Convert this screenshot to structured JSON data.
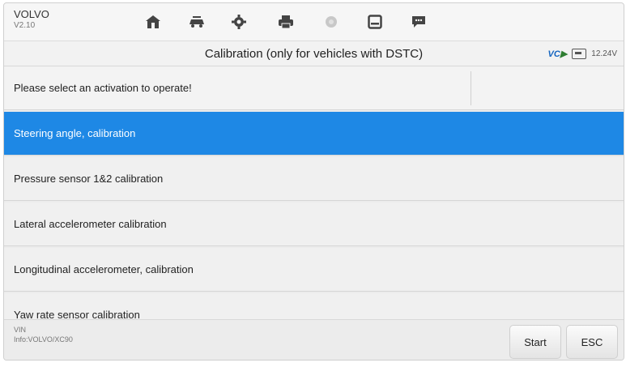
{
  "header": {
    "brand": "VOLVO",
    "version": "V2.10",
    "nav_icons": [
      "home-icon",
      "vehicle-swap-icon",
      "settings-icon",
      "print-icon",
      "record-icon",
      "save-icon",
      "message-icon"
    ]
  },
  "title": "Calibration (only for vehicles with DSTC)",
  "vci": {
    "badge": "VC",
    "voltage": "12.24V"
  },
  "list": {
    "prompt": "Please select an activation to operate!",
    "items": [
      "Steering angle, calibration",
      "Pressure sensor 1&2 calibration",
      "Lateral accelerometer calibration",
      "Longitudinal accelerometer, calibration",
      "Yaw rate sensor calibration"
    ],
    "selected": "Steering angle, calibration"
  },
  "footer": {
    "vin_label": "VIN",
    "info": "Info:VOLVO/XC90",
    "start_label": "Start",
    "esc_label": "ESC"
  },
  "colors": {
    "selected_row": "#1e88e5",
    "vci_badge": "#1565c0"
  }
}
